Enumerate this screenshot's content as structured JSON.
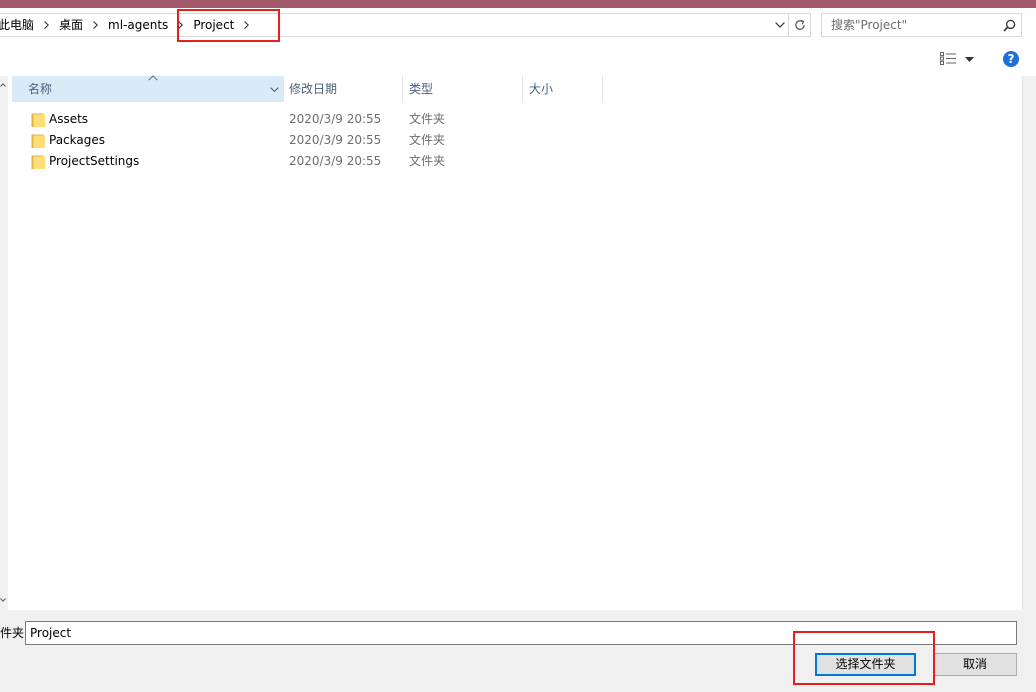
{
  "colors": {
    "title_strip": "#a35a6b",
    "sorted_column_header": "#d9ebf9",
    "accent": "#0078d7",
    "annotation": "#e3201e",
    "help_icon": "#1c6fd8"
  },
  "address_bar": {
    "breadcrumb": [
      "此电脑",
      "桌面",
      "ml-agents",
      "Project"
    ]
  },
  "search": {
    "placeholder": "搜索\"Project\""
  },
  "file_list": {
    "columns": [
      "名称",
      "修改日期",
      "类型",
      "大小"
    ],
    "rows": [
      {
        "name": "Assets",
        "modified": "2020/3/9 20:55",
        "type": "文件夹"
      },
      {
        "name": "Packages",
        "modified": "2020/3/9 20:55",
        "type": "文件夹"
      },
      {
        "name": "ProjectSettings",
        "modified": "2020/3/9 20:55",
        "type": "文件夹"
      }
    ]
  },
  "folder_field": {
    "label": "件夹:",
    "value": "Project"
  },
  "buttons": {
    "select_folder": "选择文件夹",
    "cancel": "取消"
  },
  "icons": {
    "breadcrumb_separator": "chevron-right-icon",
    "address_dropdown": "chevron-down-icon",
    "refresh": "refresh-icon",
    "search": "search-icon",
    "view": "view-details-icon",
    "view_menu": "caret-down-icon",
    "help": "help-icon",
    "name_column_sort": "sort-ascending-icon",
    "folder": "folder-icon"
  }
}
